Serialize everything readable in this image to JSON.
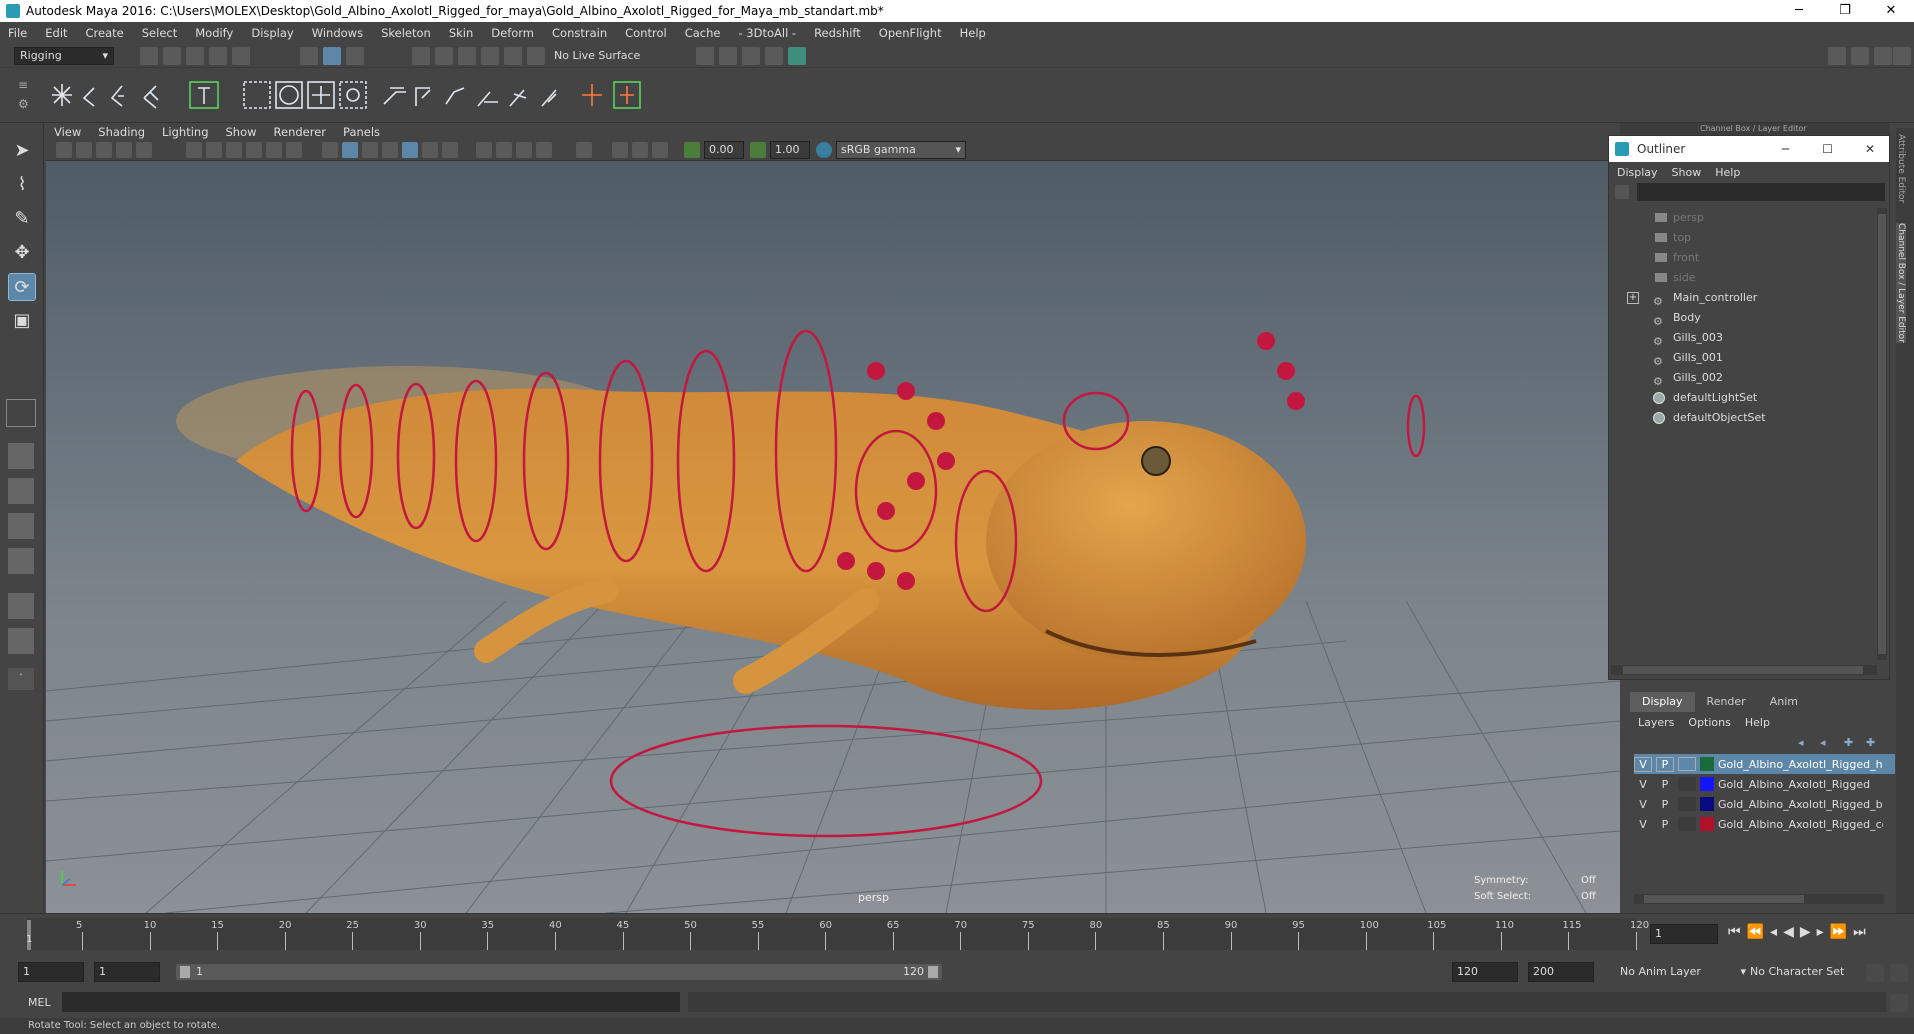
{
  "window": {
    "title": "Autodesk Maya 2016: C:\\Users\\MOLEX\\Desktop\\Gold_Albino_Axolotl_Rigged_for_maya\\Gold_Albino_Axolotl_Rigged_for_Maya_mb_standart.mb*",
    "minimize": "─",
    "restore": "❐",
    "close": "✕"
  },
  "menubar": [
    "File",
    "Edit",
    "Create",
    "Select",
    "Modify",
    "Display",
    "Windows",
    "Skeleton",
    "Skin",
    "Deform",
    "Constrain",
    "Control",
    "Cache",
    "- 3DtoAll -",
    "Redshift",
    "OpenFlight",
    "Help"
  ],
  "status_line": {
    "mode": "Rigging",
    "live_surface": "No Live Surface"
  },
  "panel_menu": [
    "View",
    "Shading",
    "Lighting",
    "Show",
    "Renderer",
    "Panels"
  ],
  "panel_toolbar": {
    "exposure": "0.00",
    "gamma": "1.00",
    "color_space": "sRGB gamma"
  },
  "viewport": {
    "camera": "persp",
    "symmetry_label": "Symmetry:",
    "symmetry_value": "Off",
    "soft_select_label": "Soft Select:",
    "soft_select_value": "Off"
  },
  "channel_box_title": "Channel Box / Layer Editor",
  "side_tabs": {
    "attribute_editor": "Attribute Editor",
    "channel_box": "Channel Box / Layer Editor"
  },
  "outliner": {
    "title": "Outliner",
    "menu": [
      "Display",
      "Show",
      "Help"
    ],
    "items": [
      {
        "label": "persp",
        "icon": "camera-icon",
        "dim": true
      },
      {
        "label": "top",
        "icon": "camera-icon",
        "dim": true
      },
      {
        "label": "front",
        "icon": "camera-icon",
        "dim": true
      },
      {
        "label": "side",
        "icon": "camera-icon",
        "dim": true
      },
      {
        "label": "Main_controller",
        "icon": "transform-icon",
        "dim": false,
        "expandable": true
      },
      {
        "label": "Body",
        "icon": "transform-icon",
        "dim": false
      },
      {
        "label": "Gills_003",
        "icon": "transform-icon",
        "dim": false
      },
      {
        "label": "Gills_001",
        "icon": "transform-icon",
        "dim": false
      },
      {
        "label": "Gills_002",
        "icon": "transform-icon",
        "dim": false
      },
      {
        "label": "defaultLightSet",
        "icon": "set-icon",
        "dim": false
      },
      {
        "label": "defaultObjectSet",
        "icon": "set-icon",
        "dim": false
      }
    ]
  },
  "layer_editor": {
    "tabs": [
      "Display",
      "Render",
      "Anim"
    ],
    "menu": [
      "Layers",
      "Options",
      "Help"
    ],
    "layers": [
      {
        "v": "V",
        "p": "P",
        "color": "#1a6b3a",
        "name": "Gold_Albino_Axolotl_Rigged_he",
        "selected": true
      },
      {
        "v": "V",
        "p": "P",
        "color": "#1515ff",
        "name": "Gold_Albino_Axolotl_Rigged",
        "selected": false
      },
      {
        "v": "V",
        "p": "P",
        "color": "#0a0a80",
        "name": "Gold_Albino_Axolotl_Rigged_bo",
        "selected": false
      },
      {
        "v": "V",
        "p": "P",
        "color": "#b0102a",
        "name": "Gold_Albino_Axolotl_Rigged_co",
        "selected": false
      }
    ]
  },
  "timeline": {
    "ticks": [
      "5",
      "10",
      "15",
      "20",
      "25",
      "30",
      "35",
      "40",
      "45",
      "50",
      "55",
      "60",
      "65",
      "70",
      "75",
      "80",
      "85",
      "90",
      "95",
      "100",
      "105",
      "110",
      "115",
      "120"
    ],
    "current_frame": "1",
    "start_tick": "1"
  },
  "range": {
    "start": "1",
    "anim_start": "1",
    "slider_start": "1",
    "slider_end": "120",
    "end": "120",
    "anim_end": "200",
    "anim_layer": "No Anim Layer",
    "character_set": "No Character Set"
  },
  "command_line": {
    "label": "MEL"
  },
  "help_line": "Rotate Tool: Select an object to rotate."
}
